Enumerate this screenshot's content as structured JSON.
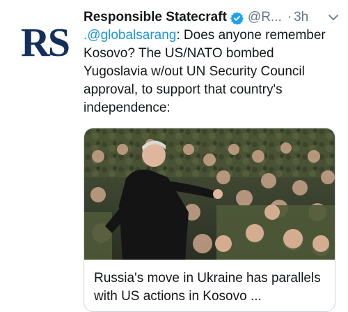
{
  "tweet": {
    "author_name": "Responsible Statecraft",
    "author_handle": "@R...",
    "separator": "·",
    "time": "3h",
    "avatar_text": "RS",
    "mention": ".@globalsarang",
    "text_rest": ": Does anyone remember Kosovo? The US/NATO bombed Yugoslavia w/out UN Security Council approval, to support that country's independence:",
    "icons": {
      "verified": "verified-badge-icon",
      "more": "chevron-down-icon"
    },
    "colors": {
      "link": "#1b95e0",
      "verified": "#1da1f2",
      "secondary": "#657786"
    }
  },
  "card": {
    "image": "photo-crowd-of-soldiers-handshake",
    "title": "Russia's move in Ukraine has parallels with US actions in Kosovo ..."
  }
}
